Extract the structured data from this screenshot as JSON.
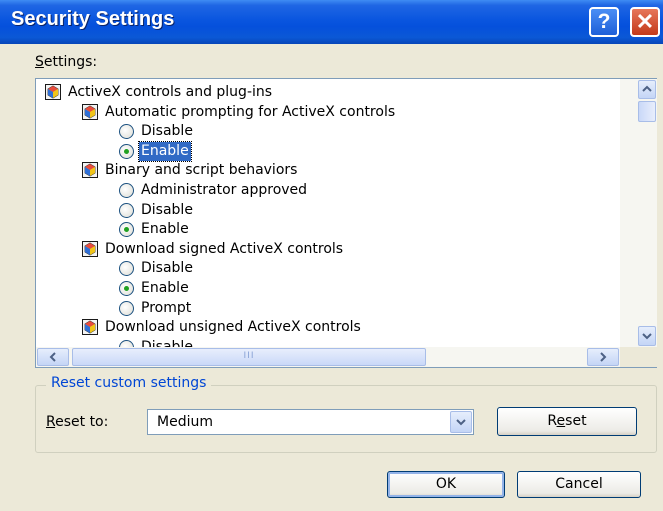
{
  "window": {
    "title": "Security Settings"
  },
  "titlebar": {
    "help_label": "?",
    "close_label": "✕"
  },
  "settings_label": "Settings:",
  "tree": [
    {
      "type": "category",
      "label": "ActiveX controls and plug-ins",
      "level": 0
    },
    {
      "type": "category",
      "label": "Automatic prompting for ActiveX controls",
      "level": 1
    },
    {
      "type": "option",
      "label": "Disable",
      "checked": false,
      "selected": false
    },
    {
      "type": "option",
      "label": "Enable",
      "checked": true,
      "selected": true
    },
    {
      "type": "category",
      "label": "Binary and script behaviors",
      "level": 1
    },
    {
      "type": "option",
      "label": "Administrator approved",
      "checked": false,
      "selected": false
    },
    {
      "type": "option",
      "label": "Disable",
      "checked": false,
      "selected": false
    },
    {
      "type": "option",
      "label": "Enable",
      "checked": true,
      "selected": false
    },
    {
      "type": "category",
      "label": "Download signed ActiveX controls",
      "level": 1
    },
    {
      "type": "option",
      "label": "Disable",
      "checked": false,
      "selected": false
    },
    {
      "type": "option",
      "label": "Enable",
      "checked": true,
      "selected": false
    },
    {
      "type": "option",
      "label": "Prompt",
      "checked": false,
      "selected": false
    },
    {
      "type": "category",
      "label": "Download unsigned ActiveX controls",
      "level": 1
    },
    {
      "type": "option",
      "label": "Disable",
      "checked": false,
      "selected": false
    }
  ],
  "scrollbar": {
    "hthumb_grip": "III"
  },
  "reset_group": {
    "legend": "Reset custom settings",
    "reset_to_label": "Reset to:",
    "reset_to_value": "Medium",
    "reset_button": "Reset"
  },
  "footer": {
    "ok_label": "OK",
    "cancel_label": "Cancel"
  },
  "colors": {
    "title_bar": "#0a56df",
    "selection": "#316ac5",
    "group_legend": "#0046d5",
    "radio_dot": "#21a121"
  }
}
